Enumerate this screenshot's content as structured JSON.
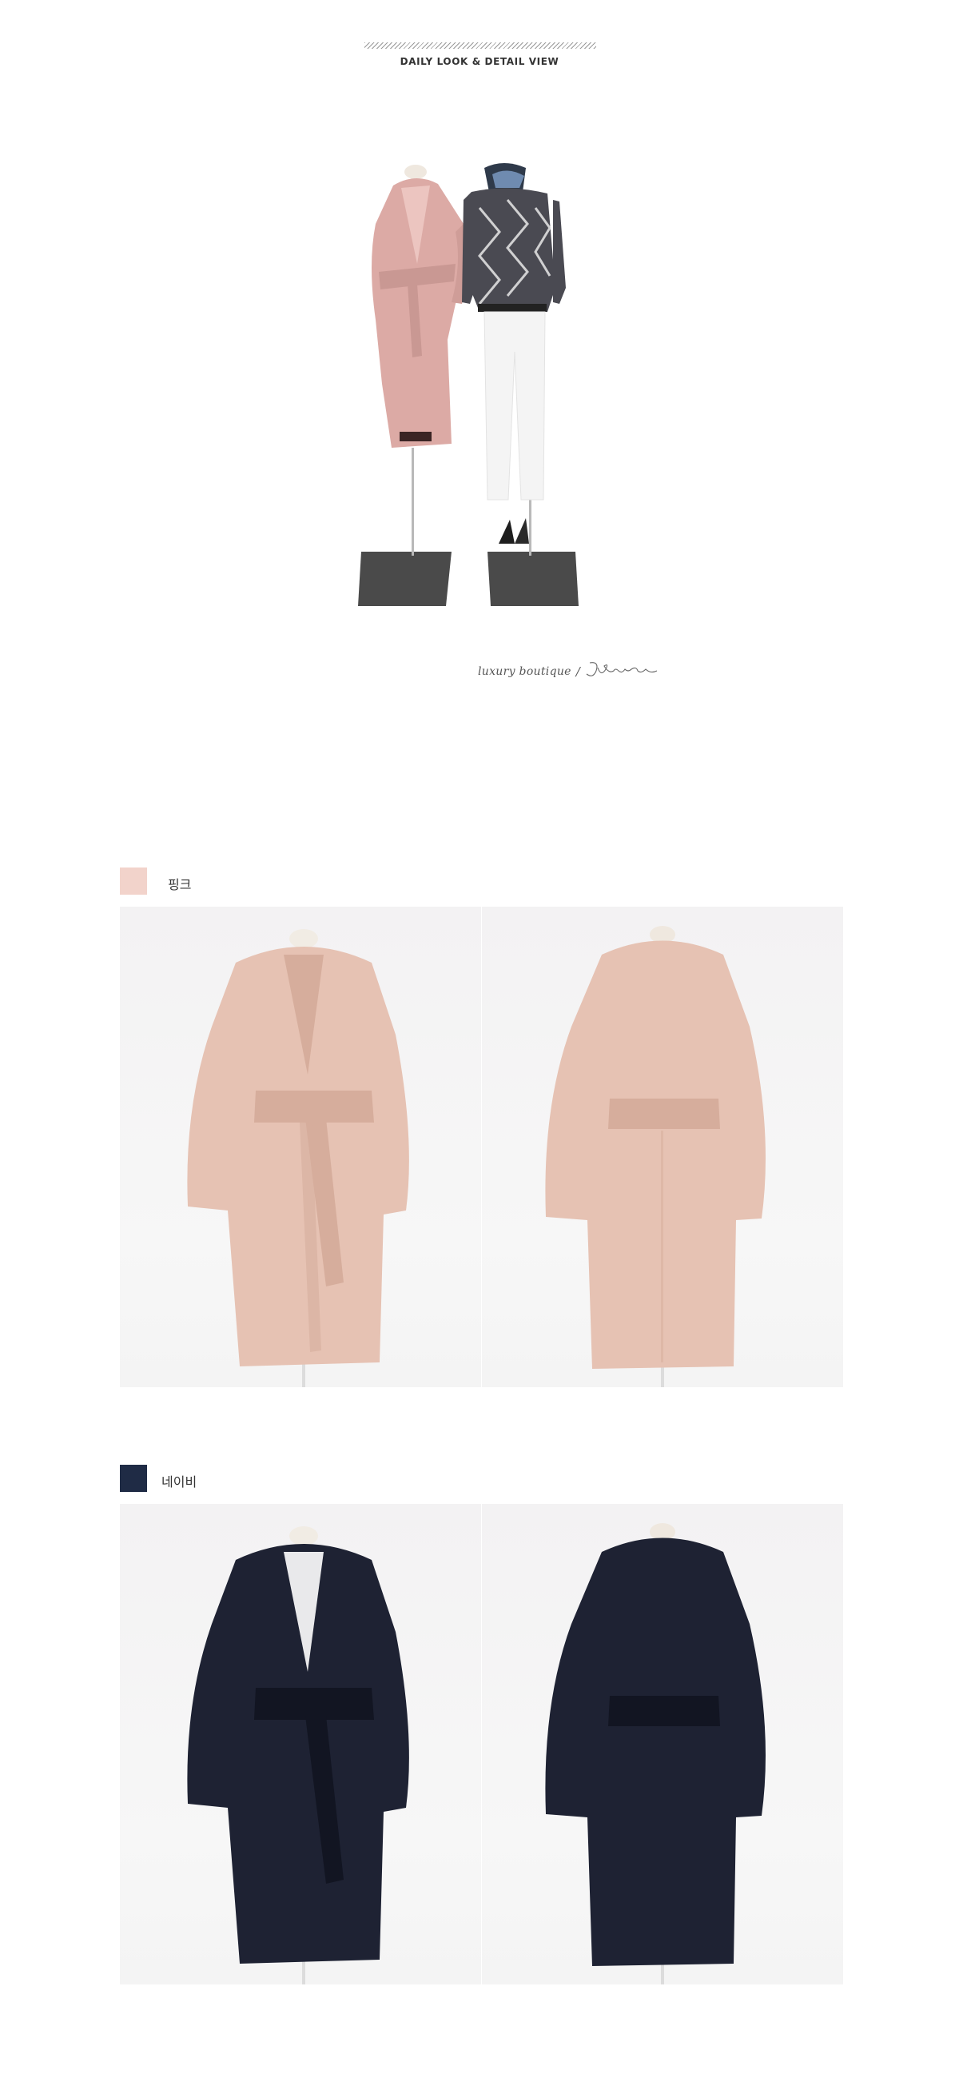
{
  "header": {
    "title": "DAILY LOOK & DETAIL VIEW"
  },
  "signature": {
    "text": "luxury boutique",
    "separator": "/",
    "logo": "Jblanc"
  },
  "colors": [
    {
      "label": "핑크",
      "swatch": "#f2d3cb",
      "coat_fill": "#e6c2b3",
      "coat_shade": "#d6ad9c"
    },
    {
      "label": "네이비",
      "swatch": "#1f2b45",
      "coat_fill": "#1e2233",
      "coat_shade": "#121522"
    }
  ],
  "icons": {
    "swatch": "color-swatch-icon",
    "logo": "signature-logo-icon"
  }
}
